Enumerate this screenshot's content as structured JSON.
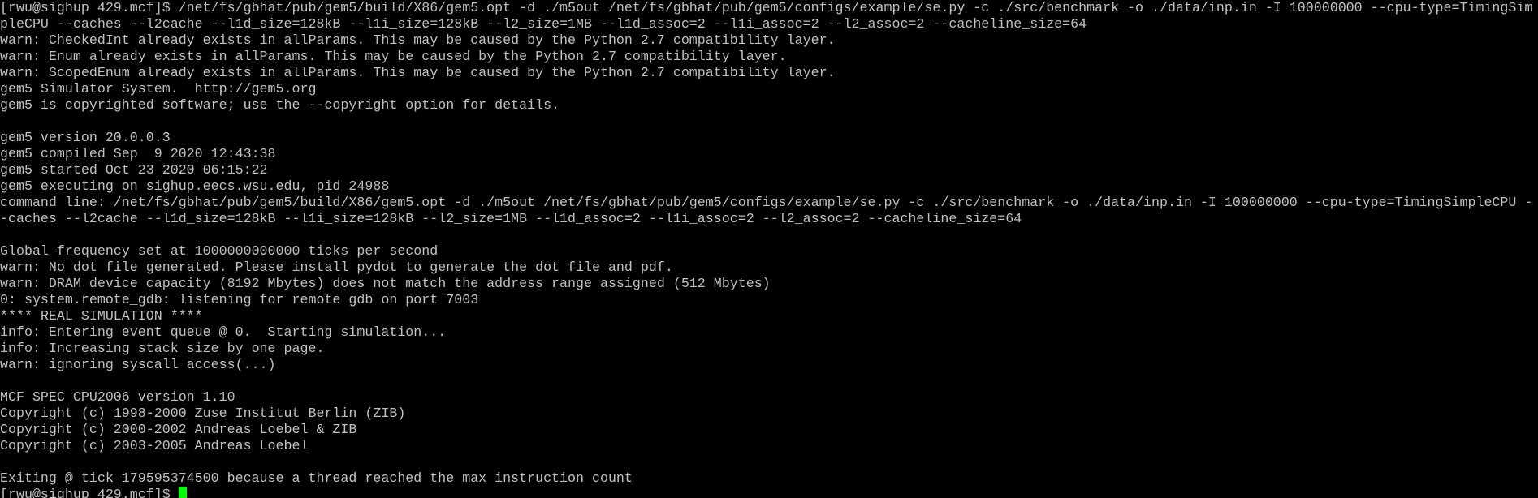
{
  "terminal": {
    "colors": {
      "background": "#000000",
      "foreground": "#c0c0c0",
      "cursor": "#00ff00"
    },
    "lines": [
      "[rwu@sighup 429.mcf]$ /net/fs/gbhat/pub/gem5/build/X86/gem5.opt -d ./m5out /net/fs/gbhat/pub/gem5/configs/example/se.py -c ./src/benchmark -o ./data/inp.in -I 100000000 --cpu-type=TimingSim",
      "pleCPU --caches --l2cache --l1d_size=128kB --l1i_size=128kB --l2_size=1MB --l1d_assoc=2 --l1i_assoc=2 --l2_assoc=2 --cacheline_size=64",
      "warn: CheckedInt already exists in allParams. This may be caused by the Python 2.7 compatibility layer.",
      "warn: Enum already exists in allParams. This may be caused by the Python 2.7 compatibility layer.",
      "warn: ScopedEnum already exists in allParams. This may be caused by the Python 2.7 compatibility layer.",
      "gem5 Simulator System.  http://gem5.org",
      "gem5 is copyrighted software; use the --copyright option for details.",
      "",
      "gem5 version 20.0.0.3",
      "gem5 compiled Sep  9 2020 12:43:38",
      "gem5 started Oct 23 2020 06:15:22",
      "gem5 executing on sighup.eecs.wsu.edu, pid 24988",
      "command line: /net/fs/gbhat/pub/gem5/build/X86/gem5.opt -d ./m5out /net/fs/gbhat/pub/gem5/configs/example/se.py -c ./src/benchmark -o ./data/inp.in -I 100000000 --cpu-type=TimingSimpleCPU -",
      "-caches --l2cache --l1d_size=128kB --l1i_size=128kB --l2_size=1MB --l1d_assoc=2 --l1i_assoc=2 --l2_assoc=2 --cacheline_size=64",
      "",
      "Global frequency set at 1000000000000 ticks per second",
      "warn: No dot file generated. Please install pydot to generate the dot file and pdf.",
      "warn: DRAM device capacity (8192 Mbytes) does not match the address range assigned (512 Mbytes)",
      "0: system.remote_gdb: listening for remote gdb on port 7003",
      "**** REAL SIMULATION ****",
      "info: Entering event queue @ 0.  Starting simulation...",
      "info: Increasing stack size by one page.",
      "warn: ignoring syscall access(...)",
      "",
      "MCF SPEC CPU2006 version 1.10",
      "Copyright (c) 1998-2000 Zuse Institut Berlin (ZIB)",
      "Copyright (c) 2000-2002 Andreas Loebel & ZIB",
      "Copyright (c) 2003-2005 Andreas Loebel",
      "",
      "Exiting @ tick 179595374500 because a thread reached the max instruction count"
    ],
    "prompt": "[rwu@sighup 429.mcf]$ "
  }
}
